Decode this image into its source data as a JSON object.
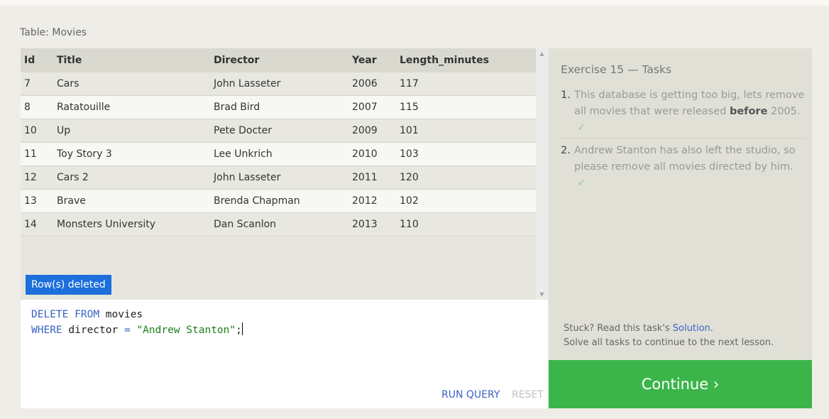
{
  "table": {
    "label": "Table: Movies",
    "columns": [
      "Id",
      "Title",
      "Director",
      "Year",
      "Length_minutes"
    ],
    "rows": [
      [
        "7",
        "Cars",
        "John Lasseter",
        "2006",
        "117"
      ],
      [
        "8",
        "Ratatouille",
        "Brad Bird",
        "2007",
        "115"
      ],
      [
        "10",
        "Up",
        "Pete Docter",
        "2009",
        "101"
      ],
      [
        "11",
        "Toy Story 3",
        "Lee Unkrich",
        "2010",
        "103"
      ],
      [
        "12",
        "Cars 2",
        "John Lasseter",
        "2011",
        "120"
      ],
      [
        "13",
        "Brave",
        "Brenda Chapman",
        "2012",
        "102"
      ],
      [
        "14",
        "Monsters University",
        "Dan Scanlon",
        "2013",
        "110"
      ]
    ],
    "status_badge": "Row(s) deleted"
  },
  "editor": {
    "line1": {
      "keyword1": "DELETE",
      "keyword2": "FROM",
      "ident": "movies"
    },
    "line2": {
      "keyword": "WHERE",
      "ident": "director",
      "op": "=",
      "string": "\"Andrew Stanton\"",
      "terminator": ";"
    },
    "run_label": "RUN QUERY",
    "reset_label": "RESET"
  },
  "tasks": {
    "title": "Exercise 15 — Tasks",
    "items": [
      {
        "number": "1.",
        "text_before": "This database is getting too big, lets remove all movies that were released ",
        "bold": "before",
        "text_after": " 2005.",
        "check": "✓"
      },
      {
        "number": "2.",
        "text": "Andrew Stanton has also left the studio, so please remove all movies directed by him.",
        "check": "✓"
      }
    ],
    "stuck_prefix": "Stuck? Read this task's ",
    "solution_link": "Solution",
    "stuck_suffix": ".",
    "continue_note": "Solve all tasks to continue to the next lesson."
  },
  "continue_label": "Continue ›",
  "icons": {
    "scroll_up": "▲",
    "scroll_down": "▼"
  },
  "colors": {
    "accent_blue": "#1d6fdb",
    "continue_green": "#3bb54a",
    "link_blue": "#3b63c4"
  }
}
